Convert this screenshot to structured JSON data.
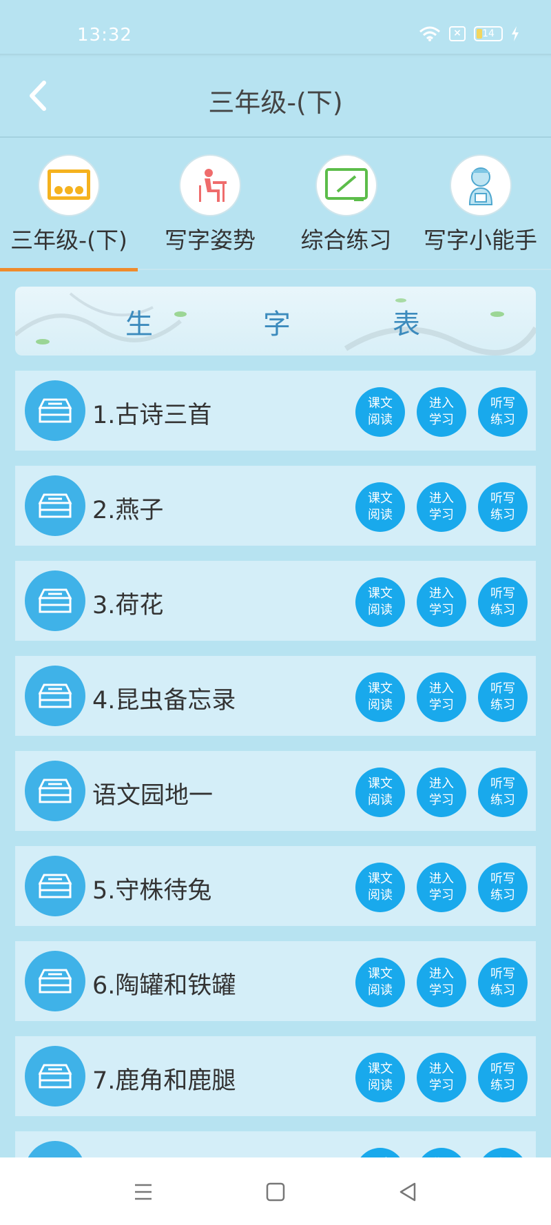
{
  "status_bar": {
    "time": "13:32",
    "battery_level": "14",
    "icons": [
      "wifi-icon",
      "sim-x-icon",
      "battery-icon",
      "charging-bolt-icon"
    ]
  },
  "header": {
    "back_icon": "chevron-left-icon",
    "title": "三年级-(下)"
  },
  "tabs": [
    {
      "label": "三年级-(下)",
      "icon": "classroom-icon",
      "active": true
    },
    {
      "label": "写字姿势",
      "icon": "writing-posture-icon",
      "active": false
    },
    {
      "label": "综合练习",
      "icon": "blackboard-icon",
      "active": false
    },
    {
      "label": "写字小能手",
      "icon": "student-avatar-icon",
      "active": false
    }
  ],
  "banner": {
    "chars": [
      "生",
      "字",
      "表"
    ]
  },
  "lessons": [
    {
      "title": "1.古诗三首"
    },
    {
      "title": "2.燕子"
    },
    {
      "title": "3.荷花"
    },
    {
      "title": "4.昆虫备忘录"
    },
    {
      "title": "语文园地一"
    },
    {
      "title": "5.守株待兔"
    },
    {
      "title": "6.陶罐和铁罐"
    },
    {
      "title": "7.鹿角和鹿腿"
    },
    {
      "title": ""
    }
  ],
  "actions": {
    "read": {
      "line1": "课文",
      "line2": "阅读"
    },
    "study": {
      "line1": "进入",
      "line2": "学习"
    },
    "dictation": {
      "line1": "听写",
      "line2": "练习"
    }
  },
  "colors": {
    "background": "#b7e3f1",
    "row": "#d4eef8",
    "accent_button": "#19a9ec",
    "lesson_icon": "#3fb2e8",
    "tab_indicator": "#ef8b2c"
  },
  "nav_bar": {
    "buttons": [
      "menu-icon",
      "home-square-icon",
      "back-triangle-icon"
    ]
  }
}
